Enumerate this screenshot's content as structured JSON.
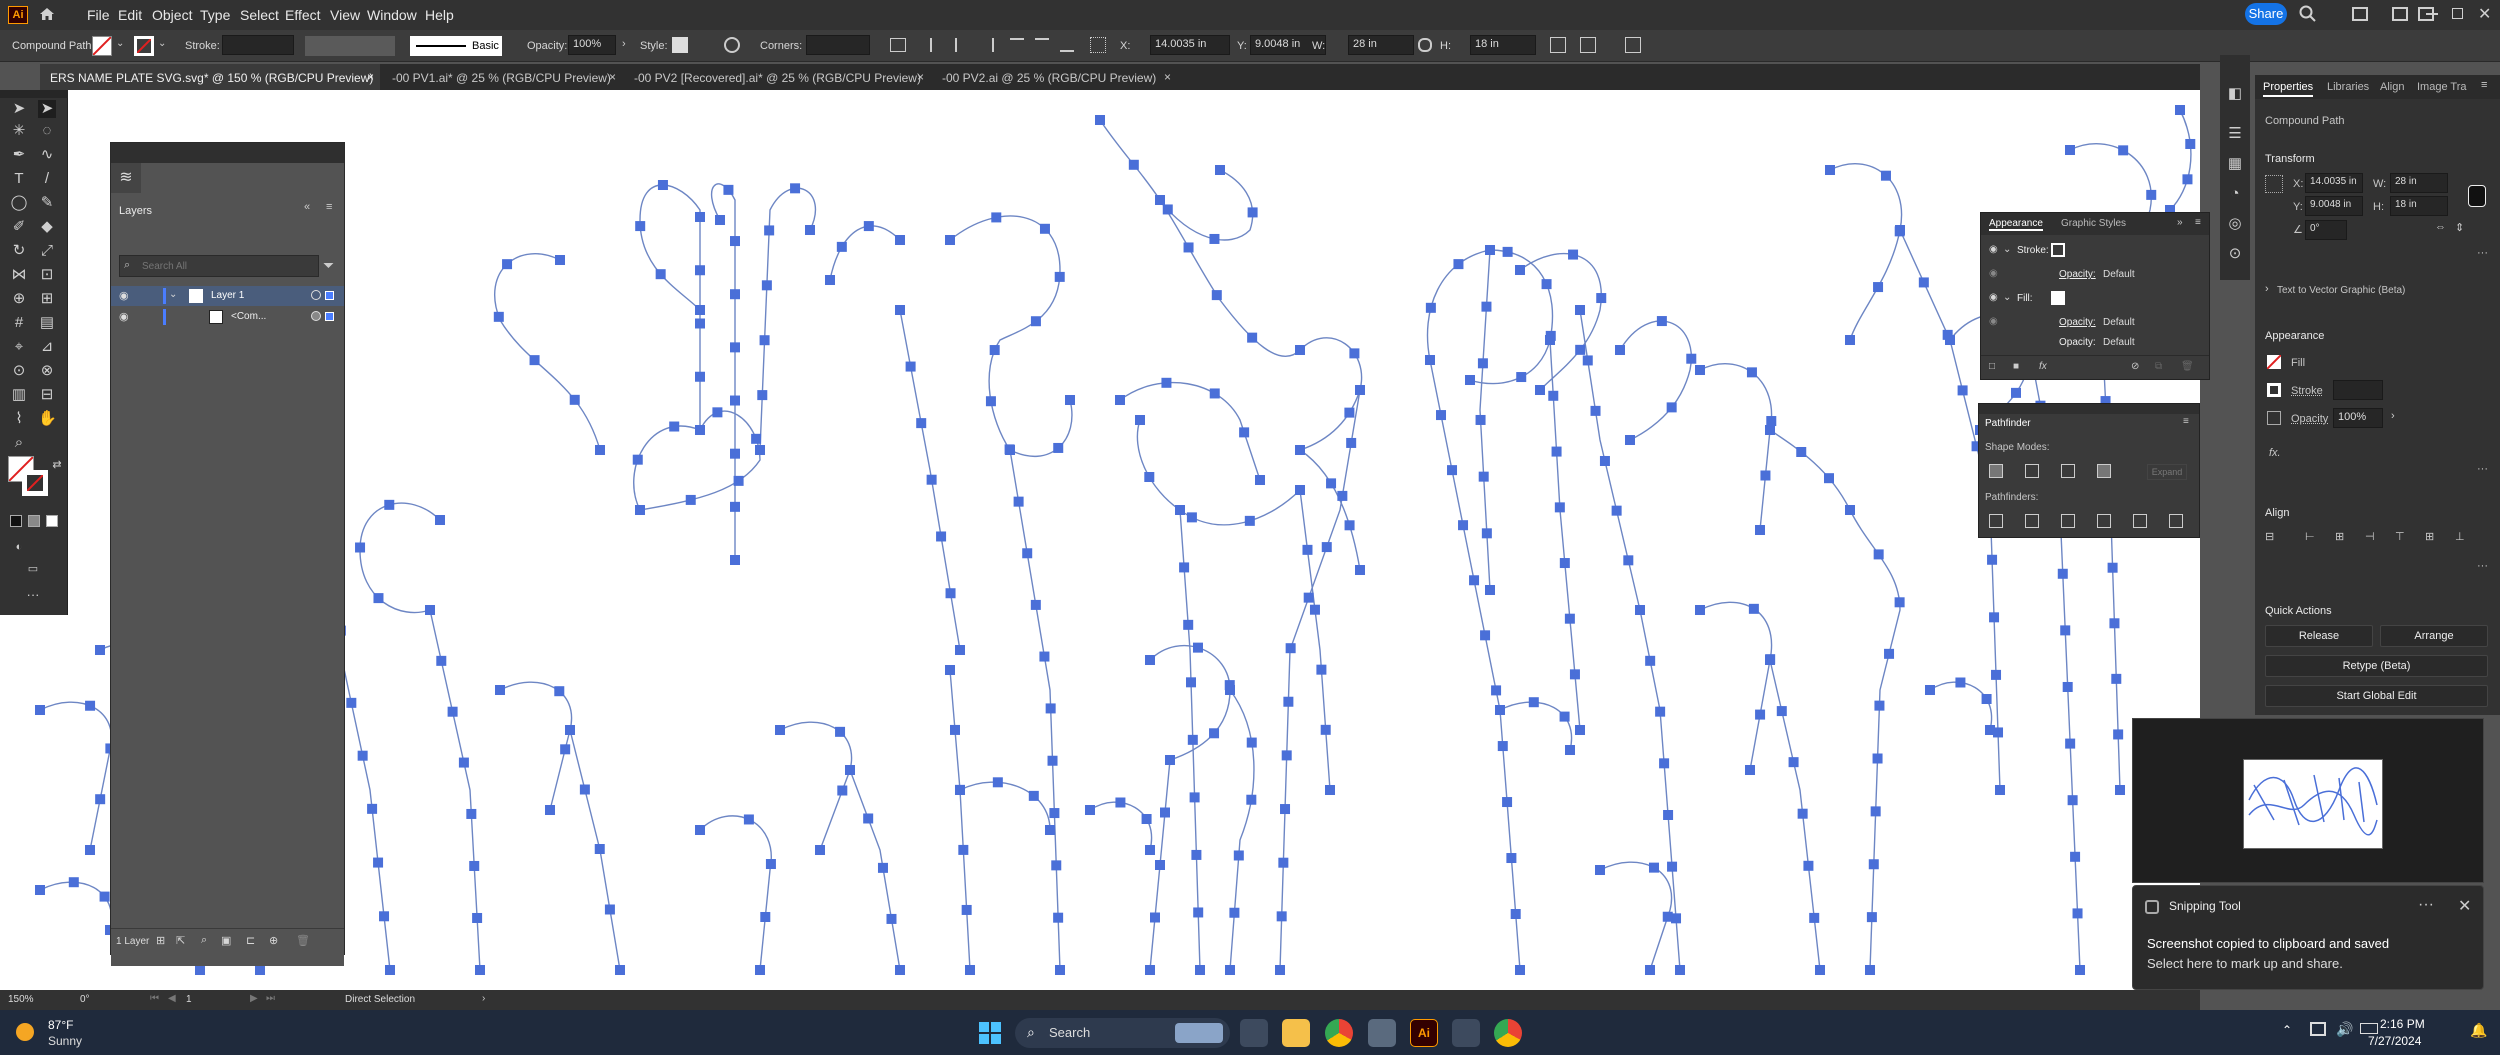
{
  "app": {
    "logo": "Ai",
    "share_label": "Share"
  },
  "menu": [
    "File",
    "Edit",
    "Object",
    "Type",
    "Select",
    "Effect",
    "View",
    "Window",
    "Help"
  ],
  "control_bar": {
    "selection_type": "Compound Path",
    "stroke_label": "Stroke:",
    "brush_label": "Basic",
    "opacity_label": "Opacity:",
    "opacity_value": "100%",
    "style_label": "Style:",
    "corners_label": "Corners:",
    "x_label": "X:",
    "x_value": "14.0035 in",
    "y_label": "Y:",
    "y_value": "9.0048 in",
    "w_label": "W:",
    "w_value": "28 in",
    "h_label": "H:",
    "h_value": "18 in"
  },
  "tabs": [
    {
      "label": "ERS NAME PLATE SVG.svg* @ 150 % (RGB/CPU Preview)",
      "active": true
    },
    {
      "label": "-00 PV1.ai* @ 25 % (RGB/CPU Preview)",
      "active": false
    },
    {
      "label": "-00 PV2 [Recovered].ai* @ 25 % (RGB/CPU Preview)",
      "active": false
    },
    {
      "label": "-00 PV2.ai @ 25 % (RGB/CPU Preview)",
      "active": false
    }
  ],
  "layers_panel": {
    "title": "Layers",
    "search_placeholder": "Search All",
    "rows": [
      {
        "name": "Layer 1",
        "level": 0
      },
      {
        "name": "<Com...",
        "level": 1
      }
    ],
    "footer_count": "1 Layer"
  },
  "properties_panel": {
    "tabs": [
      "Properties",
      "Libraries",
      "Align",
      "Image Tra"
    ],
    "selection_label": "Compound Path",
    "transform_title": "Transform",
    "x_label": "X:",
    "x_value": "14.0035 in",
    "y_label": "Y:",
    "y_value": "9.0048 in",
    "w_label": "W:",
    "w_value": "28 in",
    "h_label": "H:",
    "h_value": "18 in",
    "angle_value": "0°",
    "text_to_vector": "Text to Vector Graphic (Beta)",
    "appearance_title": "Appearance",
    "fill_label": "Fill",
    "stroke_label": "Stroke",
    "opacity_label": "Opacity",
    "opacity_value": "100%",
    "fx_label": "fx.",
    "align_title": "Align",
    "quick_actions_title": "Quick Actions",
    "release_label": "Release",
    "arrange_label": "Arrange",
    "retype_label": "Retype (Beta)",
    "global_edit_label": "Start Global Edit"
  },
  "appearance_panel": {
    "tabs": [
      "Appearance",
      "Graphic Styles"
    ],
    "rows": [
      {
        "label": "Stroke:",
        "value": ""
      },
      {
        "label": "Opacity:",
        "value": "Default"
      },
      {
        "label": "Fill:",
        "value": ""
      },
      {
        "label": "Opacity:",
        "value": "Default"
      },
      {
        "label": "Opacity:",
        "value": "Default"
      }
    ]
  },
  "pathfinder_panel": {
    "title": "Pathfinder",
    "shape_modes_label": "Shape Modes:",
    "expand_label": "Expand",
    "pathfinders_label": "Pathfinders:"
  },
  "status_bar": {
    "zoom": "150%",
    "angle": "0°",
    "artboard": "1",
    "tool": "Direct Selection"
  },
  "toast": {
    "app": "Snipping Tool",
    "title": "Screenshot copied to clipboard and saved",
    "body": "Select here to mark up and share."
  },
  "taskbar": {
    "weather_temp": "87°F",
    "weather_desc": "Sunny",
    "search_label": "Search",
    "time": "2:16 PM",
    "date": "7/27/2024"
  },
  "colors": {
    "accent": "#1473e6",
    "path": "#6d86c4",
    "anchor": "#4a6fd8",
    "menu_bg": "#323232",
    "panel_bg": "#535353"
  },
  "icons": [
    "home-icon",
    "search-icon",
    "selection-tool-icon",
    "direct-selection-icon",
    "pen-icon",
    "type-icon",
    "rectangle-icon",
    "zoom-icon",
    "eye-icon",
    "layer-icon",
    "link-icon",
    "windows-start-icon",
    "chrome-icon",
    "illustrator-icon",
    "file-explorer-icon"
  ]
}
